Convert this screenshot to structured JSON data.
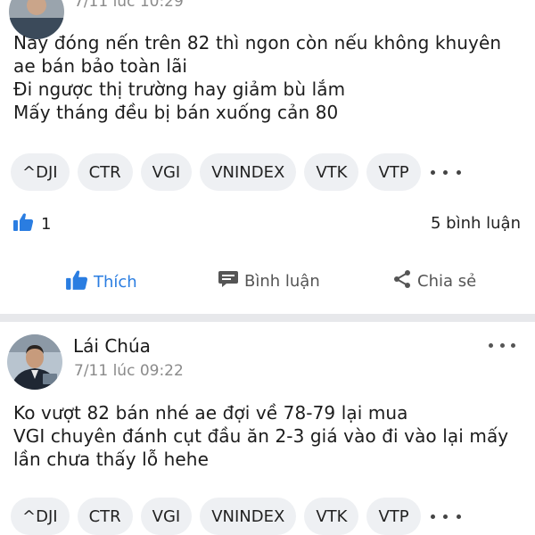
{
  "post1": {
    "timestamp": "7/11 lúc 10:29",
    "content": [
      "Nay đóng nến trên 82 thì ngon còn nếu không khuyên",
      "ae bán bảo toàn lãi",
      "Đi ngược thị trường hay giảm bù lắm",
      "Mấy tháng đều bị bán xuống cản 80"
    ],
    "tags": [
      "^DJI",
      "CTR",
      "VGI",
      "VNINDEX",
      "VTK",
      "VTP"
    ],
    "like_count": "1",
    "comment_count": "5 bình luận",
    "actions": {
      "like": "Thích",
      "comment": "Bình luận",
      "share": "Chia sẻ"
    }
  },
  "post2": {
    "author": "Lái Chúa",
    "timestamp": "7/11 lúc 09:22",
    "content": [
      "Ko vượt 82 bán nhé ae đợi về 78-79 lại mua",
      "VGI chuyên đánh cụt đầu ăn 2-3 giá vào đi vào lại mấy",
      "lần chưa thấy lỗ hehe"
    ],
    "tags": [
      "^DJI",
      "CTR",
      "VGI",
      "VNINDEX",
      "VTK",
      "VTP"
    ]
  },
  "icons": {
    "like": "thumbs-up-icon",
    "comment": "speech-bubble-icon",
    "share": "share-icon",
    "more": "more-dots-icon"
  },
  "colors": {
    "accent": "#2a7de1",
    "tag_bg": "#eef0f3",
    "divider": "#e7e8eb",
    "muted_text": "#8a8a8a"
  }
}
